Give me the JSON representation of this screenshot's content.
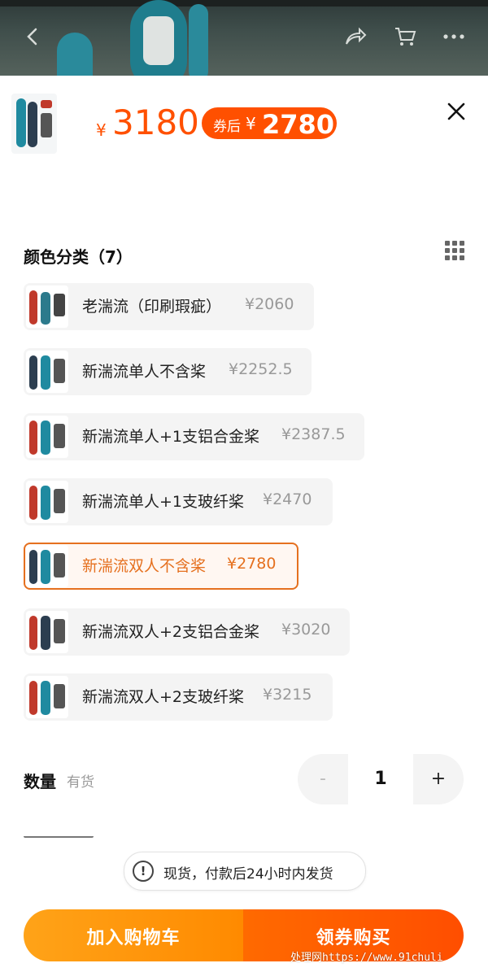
{
  "header": {
    "back_icon": "back-arrow-icon",
    "share_icon": "share-icon",
    "cart_icon": "cart-icon",
    "more_icon": "more-dots-icon"
  },
  "product": {
    "currency": "¥",
    "price": "3180",
    "coupon_label": "券后",
    "coupon_currency": "¥",
    "coupon_price": "2780"
  },
  "color_section": {
    "title": "颜色分类（7）",
    "options": [
      {
        "name": "老湍流（印刷瑕疵）",
        "price": "¥2060",
        "selected": false
      },
      {
        "name": "新湍流单人不含桨",
        "price": "¥2252.5",
        "selected": false
      },
      {
        "name": "新湍流单人+1支铝合金桨",
        "price": "¥2387.5",
        "selected": false
      },
      {
        "name": "新湍流单人+1支玻纤桨",
        "price": "¥2470",
        "selected": false
      },
      {
        "name": "新湍流双人不含桨",
        "price": "¥2780",
        "selected": true
      },
      {
        "name": "新湍流双人+2支铝合金桨",
        "price": "¥3020",
        "selected": false
      },
      {
        "name": "新湍流双人+2支玻纤桨",
        "price": "¥3215",
        "selected": false
      }
    ]
  },
  "quantity": {
    "label": "数量",
    "stock": "有货",
    "minus": "-",
    "value": "1",
    "plus": "+"
  },
  "notice": {
    "icon": "!",
    "text": "现货，付款后24小时内发货"
  },
  "actions": {
    "add_to_cart": "加入购物车",
    "buy": "领券购买"
  },
  "watermark": "处理网https://www.91chuli",
  "colors": {
    "accent": "#ff5000",
    "selected_border": "#e5701f",
    "cart_button": "#ff9a0f",
    "buy_button": "#ff5a00"
  }
}
